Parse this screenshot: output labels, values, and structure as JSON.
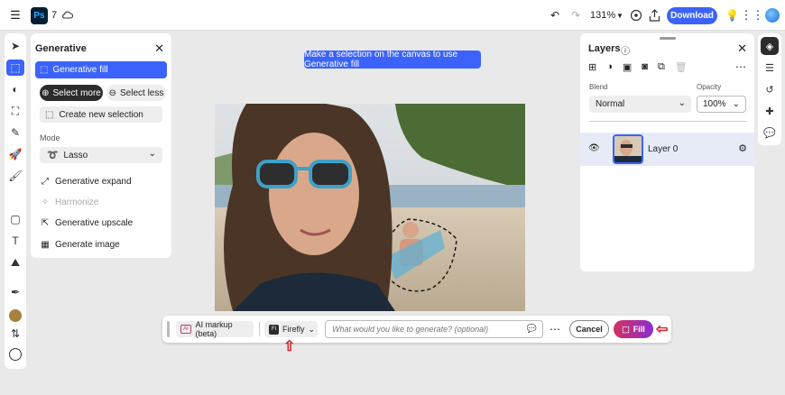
{
  "topbar": {
    "menu_icon": "hamburger-icon",
    "app_logo": "Ps",
    "version": "7",
    "cloud_icon": "cloud-icon",
    "zoom": "131%",
    "download_label": "Download"
  },
  "left_tools": [
    "select-icon",
    "generative-icon",
    "adjust-icon",
    "quick-select-icon",
    "heal-icon",
    "rocket-icon",
    "brush-icon",
    "shape-icon",
    "text-icon",
    "image-icon",
    "eyedropper-icon",
    "color-swatch",
    "swap-icon",
    "bg-swatch"
  ],
  "generative_panel": {
    "title": "Generative",
    "generative_fill": "Generative fill",
    "select_more": "Select more",
    "select_less": "Select less",
    "create_new_selection": "Create new selection",
    "mode_label": "Mode",
    "mode_value": "Lasso",
    "items": [
      {
        "label": "Generative expand",
        "icon": "expand-icon",
        "disabled": false
      },
      {
        "label": "Harmonize",
        "icon": "harmonize-icon",
        "disabled": true
      },
      {
        "label": "Generative upscale",
        "icon": "upscale-icon",
        "disabled": false
      },
      {
        "label": "Generate image",
        "icon": "generate-image-icon",
        "disabled": false
      }
    ]
  },
  "hint": "Make a selection on the canvas to use Generative fill",
  "layers_panel": {
    "title": "Layers",
    "blend_label": "Blend",
    "blend_value": "Normal",
    "opacity_label": "Opacity",
    "opacity_value": "100%",
    "layer_name": "Layer 0"
  },
  "bottom_bar": {
    "ai_markup": "AI markup (beta)",
    "model": "Firefly",
    "prompt_placeholder": "What would you like to generate? (optional)",
    "cancel": "Cancel",
    "fill": "Fill"
  },
  "colors": {
    "accent": "#3b63fb",
    "foreground_swatch": "#a8803f",
    "fill_gradient_start": "#d5305f",
    "fill_gradient_end": "#8a2fd0",
    "annotation_arrow": "#d81f26"
  }
}
